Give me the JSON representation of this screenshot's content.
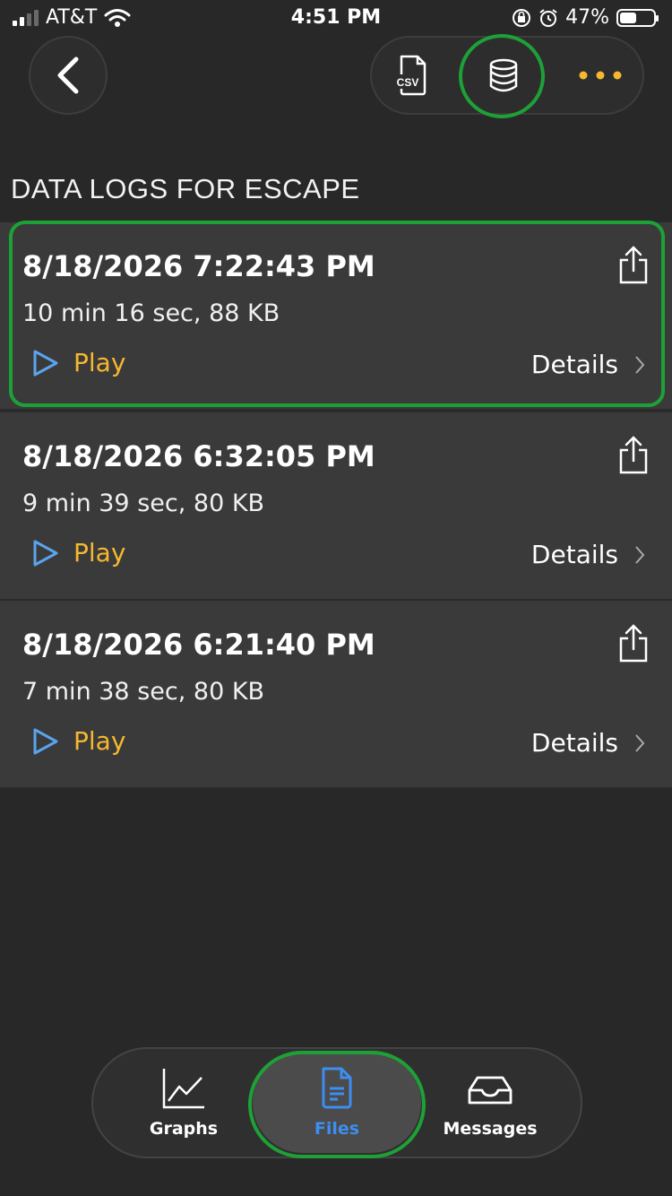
{
  "status_bar": {
    "carrier": "AT&T",
    "time": "4:51 PM",
    "battery": "47%"
  },
  "toolbar": {
    "csv_label": "CSV"
  },
  "section_title": "DATA LOGS FOR ESCAPE",
  "logs": [
    {
      "date": "8/18/2026 7:22:43 PM",
      "meta": "10 min 16 sec, 88 KB",
      "play": "Play",
      "details": "Details"
    },
    {
      "date": "8/18/2026 6:32:05 PM",
      "meta": "9 min 39 sec, 80 KB",
      "play": "Play",
      "details": "Details"
    },
    {
      "date": "8/18/2026 6:21:40 PM",
      "meta": "7 min 38 sec, 80 KB",
      "play": "Play",
      "details": "Details"
    }
  ],
  "tabs": [
    {
      "label": "Graphs",
      "icon": "graph-icon"
    },
    {
      "label": "Files",
      "icon": "file-icon",
      "active": true
    },
    {
      "label": "Messages",
      "icon": "inbox-icon"
    }
  ],
  "colors": {
    "background": "#282828",
    "card": "#3a3a3a",
    "accent_orange": "#f5b82e",
    "accent_blue": "#3d8ef0",
    "play_icon": "#5aa4ee",
    "highlight_green": "#1da137"
  }
}
